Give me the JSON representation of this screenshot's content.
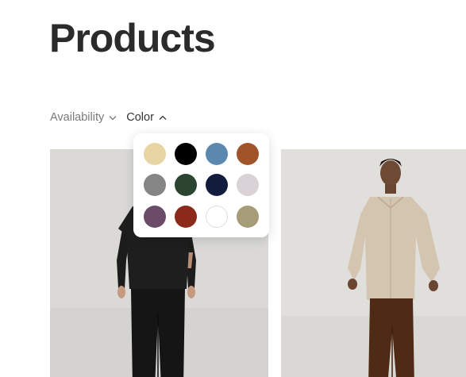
{
  "page": {
    "title": "Products"
  },
  "filters": {
    "availability_label": "Availability",
    "color_label": "Color"
  },
  "color_popover": {
    "swatches": [
      {
        "name": "beige",
        "hex": "#E8D5A4"
      },
      {
        "name": "black",
        "hex": "#000000"
      },
      {
        "name": "steel-blue",
        "hex": "#5B88AE"
      },
      {
        "name": "rust-brown",
        "hex": "#A1532A"
      },
      {
        "name": "gray",
        "hex": "#858585"
      },
      {
        "name": "dark-green",
        "hex": "#2C4530"
      },
      {
        "name": "navy",
        "hex": "#121C3D"
      },
      {
        "name": "light-lavender",
        "hex": "#D9D2D6"
      },
      {
        "name": "plum",
        "hex": "#6A4C68"
      },
      {
        "name": "red-brown",
        "hex": "#8A2A1B"
      },
      {
        "name": "white",
        "hex": "#FFFFFF"
      },
      {
        "name": "khaki",
        "hex": "#A69C78"
      }
    ]
  },
  "products": [
    {
      "description_icon": "model-in-black-tshirt-and-trousers"
    },
    {
      "description_icon": "model-in-beige-shirt-and-brown-trousers"
    }
  ]
}
